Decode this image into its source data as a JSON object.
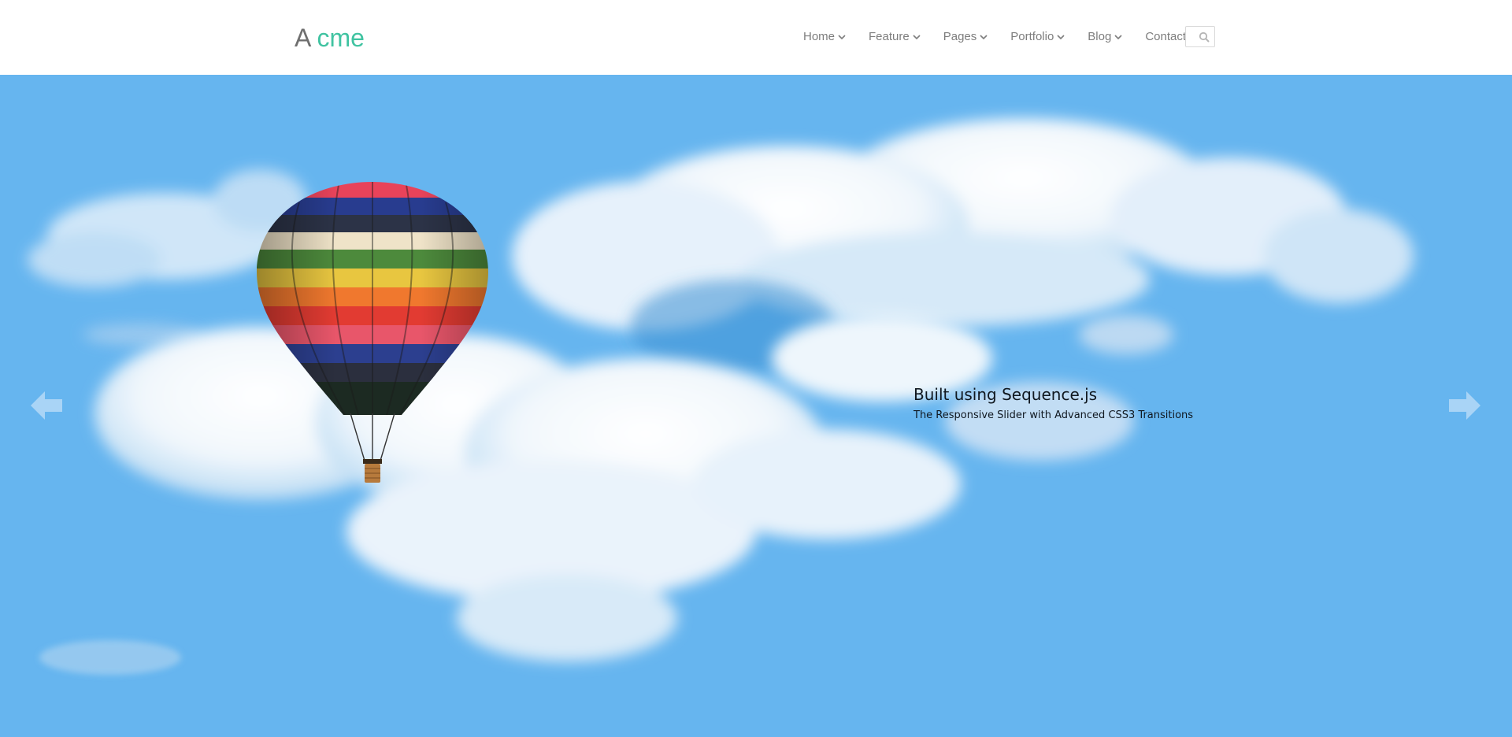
{
  "logo": {
    "part1": "A",
    "part2": "cme"
  },
  "nav": {
    "items": [
      {
        "label": "Home",
        "has_dropdown": true
      },
      {
        "label": "Feature",
        "has_dropdown": true
      },
      {
        "label": "Pages",
        "has_dropdown": true
      },
      {
        "label": "Portfolio",
        "has_dropdown": true
      },
      {
        "label": "Blog",
        "has_dropdown": true
      },
      {
        "label": "Contact",
        "has_dropdown": false
      }
    ],
    "search_icon": "search-icon"
  },
  "slider": {
    "title": "Built using Sequence.js",
    "subtitle": "The Responsive Slider with Advanced CSS3 Transitions",
    "prev_icon": "arrow-left-icon",
    "next_icon": "arrow-right-icon"
  },
  "colors": {
    "accent": "#40c3a1",
    "sky": "#66b5ef",
    "nav_text": "#7d7d7d"
  }
}
